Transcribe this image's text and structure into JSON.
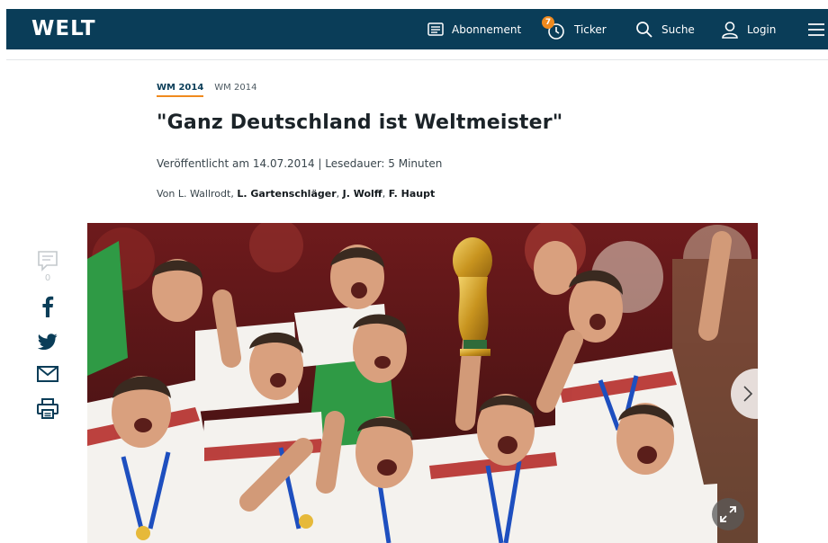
{
  "header": {
    "logo": "WELT",
    "nav": {
      "abo_label": "Abonnement",
      "ticker_label": "Ticker",
      "ticker_badge": "7",
      "search_label": "Suche",
      "login_label": "Login"
    },
    "colors": {
      "bar": "#0a3d58",
      "accent": "#f08a1e"
    }
  },
  "article": {
    "kicker_main": "WM 2014",
    "kicker_sub": "WM 2014",
    "headline": "\"Ganz Deutschland ist Weltmeister\"",
    "published": "Veröffentlicht am 14.07.2014 | Lesedauer: 5 Minuten",
    "byline": {
      "prefix": "Von L. Wallrodt, ",
      "authors": [
        "L. Gartenschläger",
        "J. Wolff",
        "F. Haupt"
      ],
      "separator": ", "
    }
  },
  "share": {
    "comment_count": "0",
    "icons": [
      "comment-icon",
      "facebook-icon",
      "twitter-icon",
      "mail-icon",
      "print-icon"
    ]
  },
  "hero": {
    "icons": [
      "chevron-right-icon",
      "expand-icon"
    ]
  }
}
